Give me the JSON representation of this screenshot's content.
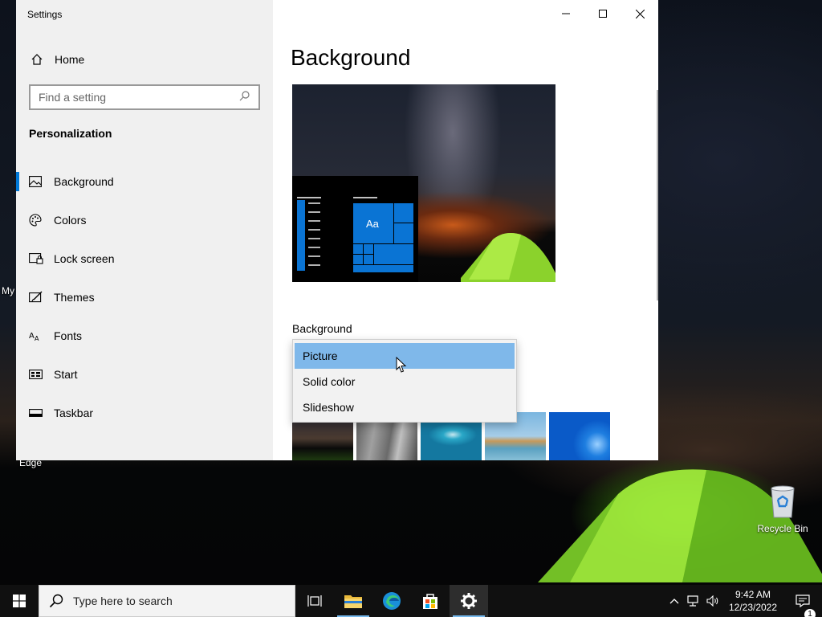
{
  "window": {
    "title": "Settings"
  },
  "sidebar": {
    "home_label": "Home",
    "search_placeholder": "Find a setting",
    "section_title": "Personalization",
    "items": [
      {
        "label": "Background",
        "icon": "picture-icon",
        "active": true
      },
      {
        "label": "Colors",
        "icon": "palette-icon"
      },
      {
        "label": "Lock screen",
        "icon": "lock-screen-icon"
      },
      {
        "label": "Themes",
        "icon": "themes-icon"
      },
      {
        "label": "Fonts",
        "icon": "fonts-icon"
      },
      {
        "label": "Start",
        "icon": "start-icon"
      },
      {
        "label": "Taskbar",
        "icon": "taskbar-icon"
      }
    ]
  },
  "main": {
    "page_title": "Background",
    "preview_tile_label": "Aa",
    "background_label": "Background",
    "dropdown": {
      "options": [
        "Picture",
        "Solid color",
        "Slideshow"
      ],
      "selected": "Picture"
    }
  },
  "desktop": {
    "icons": [
      {
        "label": "Recycle Bin",
        "icon": "recycle-bin-icon"
      }
    ],
    "partial_labels": [
      "My",
      "Edge"
    ]
  },
  "taskbar": {
    "search_placeholder": "Type here to search",
    "time": "9:42 AM",
    "date": "12/23/2022",
    "notification_count": "1"
  },
  "colors": {
    "accent": "#0078d7",
    "dropdown_selected": "#7fb8ea",
    "sidebar_bg": "#f0f0f0",
    "taskbar_bg": "#101010"
  }
}
